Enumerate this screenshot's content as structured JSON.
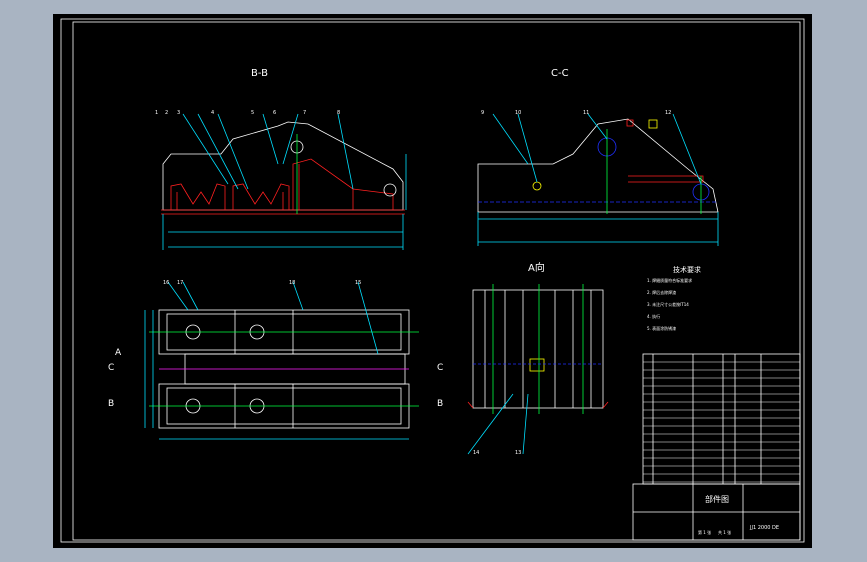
{
  "views": {
    "bb": "B-B",
    "cc": "C-C",
    "a": "A向"
  },
  "section_marks": {
    "a_left": "A",
    "c_left": "C",
    "b_left": "B",
    "c_right": "C",
    "b_right": "B"
  },
  "balloons": [
    "1",
    "2",
    "3",
    "4",
    "5",
    "6",
    "7",
    "8",
    "9",
    "10",
    "11",
    "12",
    "13",
    "14",
    "15",
    "16",
    "17",
    "18"
  ],
  "tech_req": {
    "title": "技术要求",
    "lines": [
      "1. 焊缝质量符合标准要求",
      "2. 焊后去除焊渣",
      "3. 未注尺寸公差按IT14",
      "4. 执行",
      "5. 表面涂防锈漆"
    ]
  },
  "title_block": {
    "part_name": "部件图",
    "code": "JJ1 2000 DE",
    "sheet": "第 1 张",
    "total": "共 1 张"
  }
}
